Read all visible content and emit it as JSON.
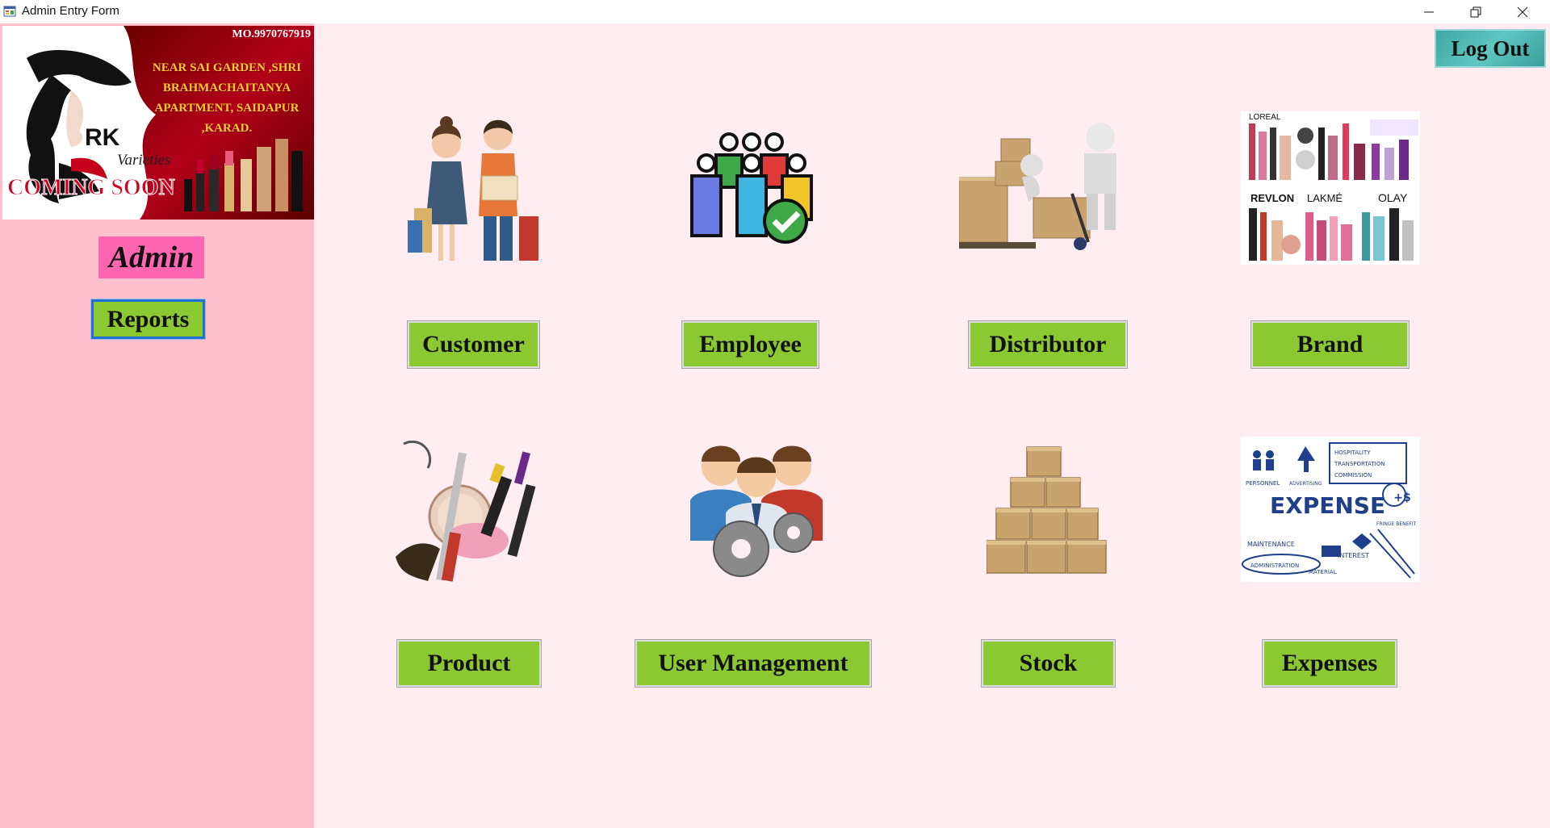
{
  "window": {
    "title": "Admin Entry Form"
  },
  "banner": {
    "phone": "MO.9970767919",
    "address": "NEAR SAI GARDEN ,SHRI BRAHMACHAITANYA APARTMENT, SAIDAPUR ,KARAD.",
    "logo_text": "RK",
    "logo_subtext": "Varieties",
    "tagline": "COMING SOON"
  },
  "sidebar": {
    "admin_label": "Admin",
    "reports_label": "Reports"
  },
  "header": {
    "logout_label": "Log Out"
  },
  "tiles": [
    {
      "label": "Customer",
      "icon": "shopping-couple-icon"
    },
    {
      "label": "Employee",
      "icon": "employee-group-icon"
    },
    {
      "label": "Distributor",
      "icon": "delivery-boxes-icon"
    },
    {
      "label": "Brand",
      "icon": "cosmetic-brands-icon"
    },
    {
      "label": "Product",
      "icon": "cosmetics-icon"
    },
    {
      "label": "User Management",
      "icon": "users-gears-icon"
    },
    {
      "label": "Stock",
      "icon": "box-stack-icon"
    },
    {
      "label": "Expenses",
      "icon": "expense-chart-icon"
    }
  ],
  "brand_names": [
    "LOREAL",
    "REVLON",
    "LAKMÉ",
    "OLAY"
  ],
  "expense_words": [
    "EXPENSE",
    "PERSONNEL",
    "ADVERTISING",
    "MAINTENANCE",
    "ADMINISTRATION",
    "MATERIAL",
    "INTEREST",
    "HOSPITALITY",
    "TRANSPORTATION",
    "COMMISSION",
    "FRINGE BENEFIT"
  ],
  "colors": {
    "sidebar_bg": "#ffbfcc",
    "main_bg": "#ffedf2",
    "button_green": "#8cc832",
    "admin_pink": "#ff66b2",
    "logout_teal": "#4fb8b3"
  }
}
